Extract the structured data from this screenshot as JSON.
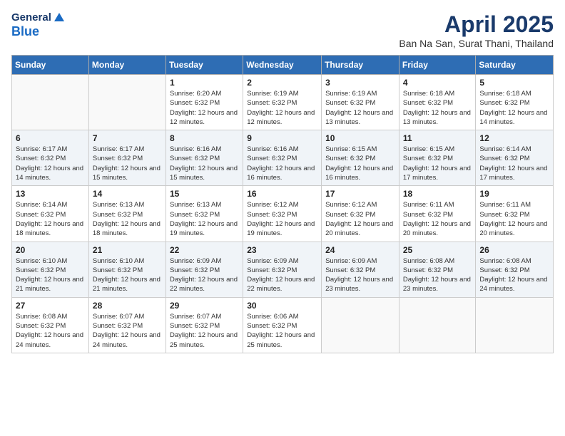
{
  "logo": {
    "general": "General",
    "blue": "Blue"
  },
  "title": "April 2025",
  "subtitle": "Ban Na San, Surat Thani, Thailand",
  "weekdays": [
    "Sunday",
    "Monday",
    "Tuesday",
    "Wednesday",
    "Thursday",
    "Friday",
    "Saturday"
  ],
  "weeks": [
    [
      {
        "day": "",
        "info": ""
      },
      {
        "day": "",
        "info": ""
      },
      {
        "day": "1",
        "info": "Sunrise: 6:20 AM\nSunset: 6:32 PM\nDaylight: 12 hours and 12 minutes."
      },
      {
        "day": "2",
        "info": "Sunrise: 6:19 AM\nSunset: 6:32 PM\nDaylight: 12 hours and 12 minutes."
      },
      {
        "day": "3",
        "info": "Sunrise: 6:19 AM\nSunset: 6:32 PM\nDaylight: 12 hours and 13 minutes."
      },
      {
        "day": "4",
        "info": "Sunrise: 6:18 AM\nSunset: 6:32 PM\nDaylight: 12 hours and 13 minutes."
      },
      {
        "day": "5",
        "info": "Sunrise: 6:18 AM\nSunset: 6:32 PM\nDaylight: 12 hours and 14 minutes."
      }
    ],
    [
      {
        "day": "6",
        "info": "Sunrise: 6:17 AM\nSunset: 6:32 PM\nDaylight: 12 hours and 14 minutes."
      },
      {
        "day": "7",
        "info": "Sunrise: 6:17 AM\nSunset: 6:32 PM\nDaylight: 12 hours and 15 minutes."
      },
      {
        "day": "8",
        "info": "Sunrise: 6:16 AM\nSunset: 6:32 PM\nDaylight: 12 hours and 15 minutes."
      },
      {
        "day": "9",
        "info": "Sunrise: 6:16 AM\nSunset: 6:32 PM\nDaylight: 12 hours and 16 minutes."
      },
      {
        "day": "10",
        "info": "Sunrise: 6:15 AM\nSunset: 6:32 PM\nDaylight: 12 hours and 16 minutes."
      },
      {
        "day": "11",
        "info": "Sunrise: 6:15 AM\nSunset: 6:32 PM\nDaylight: 12 hours and 17 minutes."
      },
      {
        "day": "12",
        "info": "Sunrise: 6:14 AM\nSunset: 6:32 PM\nDaylight: 12 hours and 17 minutes."
      }
    ],
    [
      {
        "day": "13",
        "info": "Sunrise: 6:14 AM\nSunset: 6:32 PM\nDaylight: 12 hours and 18 minutes."
      },
      {
        "day": "14",
        "info": "Sunrise: 6:13 AM\nSunset: 6:32 PM\nDaylight: 12 hours and 18 minutes."
      },
      {
        "day": "15",
        "info": "Sunrise: 6:13 AM\nSunset: 6:32 PM\nDaylight: 12 hours and 19 minutes."
      },
      {
        "day": "16",
        "info": "Sunrise: 6:12 AM\nSunset: 6:32 PM\nDaylight: 12 hours and 19 minutes."
      },
      {
        "day": "17",
        "info": "Sunrise: 6:12 AM\nSunset: 6:32 PM\nDaylight: 12 hours and 20 minutes."
      },
      {
        "day": "18",
        "info": "Sunrise: 6:11 AM\nSunset: 6:32 PM\nDaylight: 12 hours and 20 minutes."
      },
      {
        "day": "19",
        "info": "Sunrise: 6:11 AM\nSunset: 6:32 PM\nDaylight: 12 hours and 20 minutes."
      }
    ],
    [
      {
        "day": "20",
        "info": "Sunrise: 6:10 AM\nSunset: 6:32 PM\nDaylight: 12 hours and 21 minutes."
      },
      {
        "day": "21",
        "info": "Sunrise: 6:10 AM\nSunset: 6:32 PM\nDaylight: 12 hours and 21 minutes."
      },
      {
        "day": "22",
        "info": "Sunrise: 6:09 AM\nSunset: 6:32 PM\nDaylight: 12 hours and 22 minutes."
      },
      {
        "day": "23",
        "info": "Sunrise: 6:09 AM\nSunset: 6:32 PM\nDaylight: 12 hours and 22 minutes."
      },
      {
        "day": "24",
        "info": "Sunrise: 6:09 AM\nSunset: 6:32 PM\nDaylight: 12 hours and 23 minutes."
      },
      {
        "day": "25",
        "info": "Sunrise: 6:08 AM\nSunset: 6:32 PM\nDaylight: 12 hours and 23 minutes."
      },
      {
        "day": "26",
        "info": "Sunrise: 6:08 AM\nSunset: 6:32 PM\nDaylight: 12 hours and 24 minutes."
      }
    ],
    [
      {
        "day": "27",
        "info": "Sunrise: 6:08 AM\nSunset: 6:32 PM\nDaylight: 12 hours and 24 minutes."
      },
      {
        "day": "28",
        "info": "Sunrise: 6:07 AM\nSunset: 6:32 PM\nDaylight: 12 hours and 24 minutes."
      },
      {
        "day": "29",
        "info": "Sunrise: 6:07 AM\nSunset: 6:32 PM\nDaylight: 12 hours and 25 minutes."
      },
      {
        "day": "30",
        "info": "Sunrise: 6:06 AM\nSunset: 6:32 PM\nDaylight: 12 hours and 25 minutes."
      },
      {
        "day": "",
        "info": ""
      },
      {
        "day": "",
        "info": ""
      },
      {
        "day": "",
        "info": ""
      }
    ]
  ]
}
